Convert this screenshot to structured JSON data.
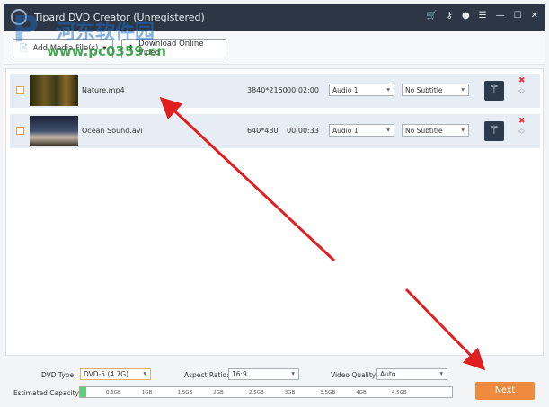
{
  "app": {
    "title": "Tipard DVD Creator (Unregistered)"
  },
  "window_icons": [
    "cart-icon",
    "key-icon",
    "feedback-icon",
    "menu-icon",
    "minimize-icon",
    "maximize-icon",
    "close-icon"
  ],
  "toolbar": {
    "add_media": "Add Media File(s)",
    "download": "Download Online Video"
  },
  "files": [
    {
      "name": "Nature.mp4",
      "resolution": "3840*2160",
      "duration": "00:02:00",
      "audio": "Audio 1",
      "subtitle": "No Subtitle"
    },
    {
      "name": "Ocean Sound.avi",
      "resolution": "640*480",
      "duration": "00:00:33",
      "audio": "Audio 1",
      "subtitle": "No Subtitle"
    }
  ],
  "settings": {
    "dvd_type_label": "DVD Type:",
    "dvd_type": "DVD-5 (4.7G)",
    "aspect_label": "Aspect Ratio:",
    "aspect": "16:9",
    "quality_label": "Video Quality:",
    "quality": "Auto",
    "capacity_label": "Estimated Capacity:",
    "capacity_ticks": [
      "0.5GB",
      "1GB",
      "1.5GB",
      "2GB",
      "2.5GB",
      "3GB",
      "3.5GB",
      "4GB",
      "4.5GB"
    ],
    "capacity_used_fraction": 0.017
  },
  "next_label": "Next",
  "watermark": {
    "cn": "河东软件园",
    "url": "www.pc0359.cn"
  },
  "colors": {
    "titlebar": "#2c3645",
    "accent": "#ef8a3e",
    "arrow": "#e02020"
  }
}
